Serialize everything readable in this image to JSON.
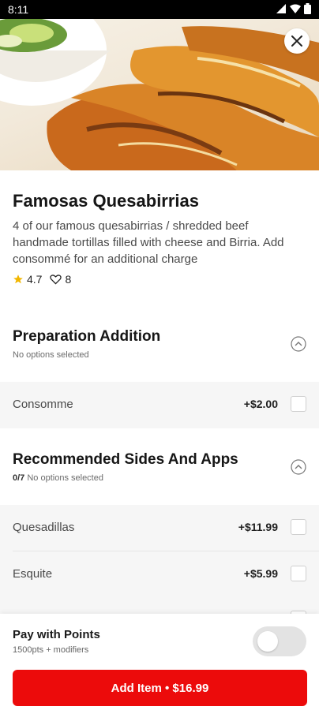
{
  "status_bar": {
    "time": "8:11"
  },
  "item": {
    "name": "Famosas Quesabirrias",
    "description": "4 of our famous quesabirrias / shredded beef handmade tortillas filled with cheese and Birria. Add consommé for an additional charge",
    "rating": "4.7",
    "likes": "8"
  },
  "sections": [
    {
      "title": "Preparation Addition",
      "subtitle": "No options selected",
      "options": [
        {
          "name": "Consomme",
          "price": "+$2.00"
        }
      ]
    },
    {
      "title": "Recommended Sides And Apps",
      "count": "0/7",
      "subtitle": "No options selected",
      "options": [
        {
          "name": "Quesadillas",
          "price": "+$11.99"
        },
        {
          "name": "Esquite",
          "price": "+$5.99"
        }
      ]
    }
  ],
  "footer": {
    "pay_title": "Pay with Points",
    "pay_subtitle": "1500pts + modifiers",
    "toggle_on": false,
    "add_button": "Add Item • $16.99"
  },
  "colors": {
    "accent": "#ec0b0b",
    "star": "#f2b600"
  },
  "icons": [
    "signal-icon",
    "wifi-icon",
    "battery-icon",
    "close-icon",
    "star-icon",
    "heart-icon",
    "chevron-up-icon"
  ]
}
